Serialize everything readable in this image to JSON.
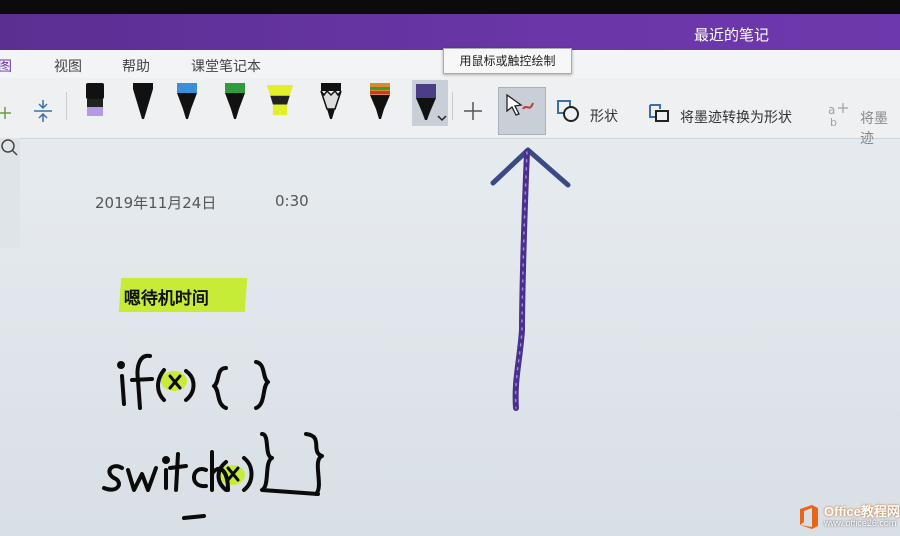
{
  "window": {
    "title": "最近的笔记"
  },
  "tabs": [
    {
      "label": "图",
      "active": true
    },
    {
      "label": "视图"
    },
    {
      "label": "帮助"
    },
    {
      "label": "课堂笔记本"
    }
  ],
  "tooltip": "用鼠标或触控绘制",
  "toolbar": {
    "pens": [
      {
        "icon": "highlighter-purple-icon",
        "color": "#b49ae6"
      },
      {
        "icon": "pen-black-icon",
        "color": "#111111"
      },
      {
        "icon": "pen-blue-icon",
        "color": "#3b8fd8"
      },
      {
        "icon": "pen-green-icon",
        "color": "#2f9b3a"
      },
      {
        "icon": "highlighter-yellow-icon",
        "color": "#e2ef2a"
      },
      {
        "icon": "pen-galaxy-icon",
        "color": "#222222"
      },
      {
        "icon": "pen-rainbow-icon",
        "color": "#d98a2b"
      },
      {
        "icon": "pen-galaxy-selected-icon",
        "color": "#4b3d86"
      }
    ],
    "shape_label": "形状",
    "ink_to_shape_label": "将墨迹转换为形状",
    "ink_to_math_label": "将墨迹"
  },
  "page": {
    "date": "2019年11月24日",
    "time": "0:30",
    "highlight_note": "嗯待机时间"
  },
  "colors": {
    "accent": "#6a36a8",
    "highlight": "#c7ec37",
    "ink_arrow": "#4a2f8f"
  },
  "watermark": {
    "title": "Office教程网",
    "url": "www.office26.com"
  }
}
